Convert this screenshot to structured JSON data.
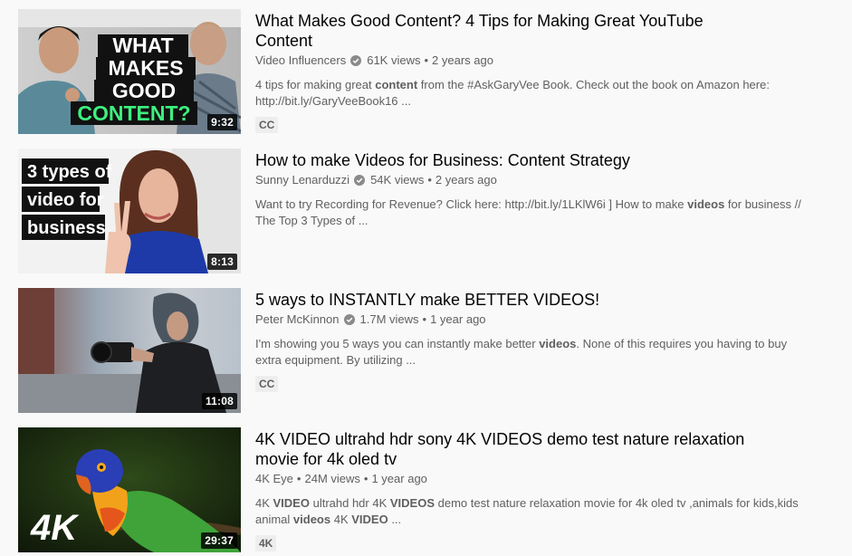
{
  "results": [
    {
      "title_line1": "What Makes Good Content? 4 Tips for Making Great YouTube",
      "title_line2": "Content",
      "channel": "Video Influencers",
      "views": "61K views",
      "age": "2 years ago",
      "desc_a": "4 tips for making great ",
      "desc_bold": "content",
      "desc_b": " from the #AskGaryVee Book. Check out the book on Amazon here:",
      "desc_c": "http://bit.ly/GaryVeeBook16 ...",
      "badge": "CC",
      "duration": "9:32",
      "thumb_text": [
        "WHAT",
        "MAKES",
        "GOOD",
        "CONTENT?"
      ]
    },
    {
      "title_line1": "How to make Videos for Business: Content Strategy",
      "channel": "Sunny Lenarduzzi",
      "views": "54K views",
      "age": "2 years ago",
      "desc_a": "Want to try Recording for Revenue? Click here: http://bit.ly/1LKlW6i ] How to make ",
      "desc_bold": "videos",
      "desc_b": " for business //",
      "desc_c": "The Top 3 Types of ...",
      "duration": "8:13",
      "thumb_text": [
        "3 types of",
        "video for",
        "business"
      ]
    },
    {
      "title_line1": "5 ways to INSTANTLY make BETTER VIDEOS!",
      "channel": "Peter McKinnon",
      "views": "1.7M views",
      "age": "1 year ago",
      "desc_a": "I'm showing you 5 ways you can instantly make better ",
      "desc_bold": "videos",
      "desc_b": ". None of this requires you having to buy",
      "desc_c": "extra equipment. By utilizing ...",
      "badge": "CC",
      "duration": "11:08"
    },
    {
      "title_line1": "4K VIDEO ultrahd hdr sony 4K VIDEOS demo test nature relaxation",
      "title_line2": "movie for 4k oled tv",
      "channel": "4K Eye",
      "views": "24M views",
      "age": "1 year ago",
      "desc_a": "4K ",
      "desc_bold": "VIDEO",
      "desc_b": " ultrahd hdr 4K ",
      "desc_bold2": "VIDEOS",
      "desc_b2": " demo test nature relaxation movie for 4k oled tv ,animals for kids,kids",
      "desc_c_a": "animal ",
      "desc_c_bold": "videos",
      "desc_c_b": " 4K ",
      "desc_c_bold2": "VIDEO",
      "desc_c_c": " ...",
      "badge": "4K",
      "duration": "29:37",
      "thumb_text": [
        "4K"
      ]
    }
  ],
  "separator": "•",
  "icons": {
    "verified": "verified-check-icon"
  }
}
